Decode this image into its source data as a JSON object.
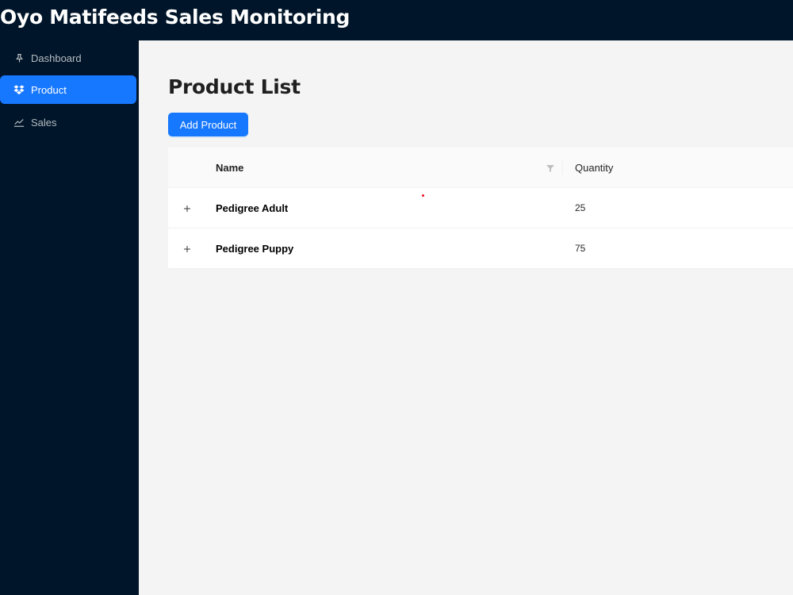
{
  "app": {
    "title": "Oyo Matifeeds Sales Monitoring"
  },
  "sidebar": {
    "items": [
      {
        "label": "Dashboard",
        "icon": "pushpin-icon",
        "active": false
      },
      {
        "label": "Product",
        "icon": "dropbox-icon",
        "active": true
      },
      {
        "label": "Sales",
        "icon": "line-chart-icon",
        "active": false
      }
    ]
  },
  "main": {
    "title": "Product List",
    "add_button_label": "Add Product",
    "table": {
      "columns": [
        "Name",
        "Quantity"
      ],
      "rows": [
        {
          "name": "Pedigree Adult",
          "quantity": "25"
        },
        {
          "name": "Pedigree Puppy",
          "quantity": "75"
        }
      ]
    }
  },
  "colors": {
    "sidebar_bg": "#001529",
    "accent": "#1677ff",
    "page_bg": "#f4f4f4"
  }
}
